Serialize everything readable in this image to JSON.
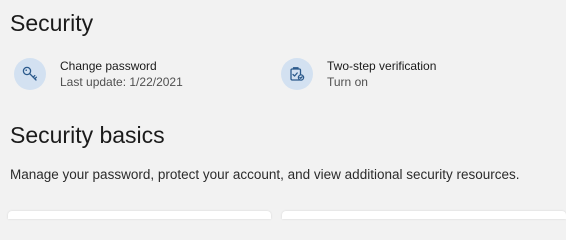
{
  "security": {
    "title": "Security",
    "items": [
      {
        "icon": "key-icon",
        "title": "Change password",
        "subtitle": "Last update: 1/22/2021"
      },
      {
        "icon": "verification-checklist-icon",
        "title": "Two-step verification",
        "subtitle": "Turn on"
      }
    ]
  },
  "security_basics": {
    "title": "Security basics",
    "description": "Manage your password, protect your account, and view additional security resources."
  },
  "colors": {
    "background": "#f2f2f2",
    "icon_circle": "#d3e1f1",
    "icon_stroke": "#2b5a8c",
    "text_primary": "#1b1b1b",
    "text_secondary": "#505050"
  }
}
